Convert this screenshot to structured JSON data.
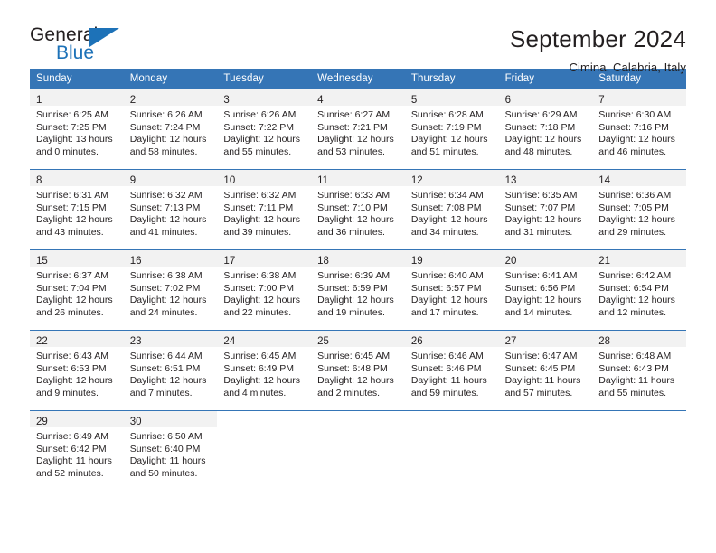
{
  "brand": {
    "name_top": "General",
    "name_bottom": "Blue",
    "accent_color": "#1d72b8"
  },
  "header": {
    "title": "September 2024",
    "location": "Cimina, Calabria, Italy"
  },
  "theme": {
    "header_band": "#3575b6",
    "day_strip": "#f2f2f2",
    "text": "#231f20"
  },
  "weekdays": [
    "Sunday",
    "Monday",
    "Tuesday",
    "Wednesday",
    "Thursday",
    "Friday",
    "Saturday"
  ],
  "weeks": [
    [
      {
        "day": "1",
        "sunrise": "Sunrise: 6:25 AM",
        "sunset": "Sunset: 7:25 PM",
        "daylight_1": "Daylight: 13 hours",
        "daylight_2": "and 0 minutes."
      },
      {
        "day": "2",
        "sunrise": "Sunrise: 6:26 AM",
        "sunset": "Sunset: 7:24 PM",
        "daylight_1": "Daylight: 12 hours",
        "daylight_2": "and 58 minutes."
      },
      {
        "day": "3",
        "sunrise": "Sunrise: 6:26 AM",
        "sunset": "Sunset: 7:22 PM",
        "daylight_1": "Daylight: 12 hours",
        "daylight_2": "and 55 minutes."
      },
      {
        "day": "4",
        "sunrise": "Sunrise: 6:27 AM",
        "sunset": "Sunset: 7:21 PM",
        "daylight_1": "Daylight: 12 hours",
        "daylight_2": "and 53 minutes."
      },
      {
        "day": "5",
        "sunrise": "Sunrise: 6:28 AM",
        "sunset": "Sunset: 7:19 PM",
        "daylight_1": "Daylight: 12 hours",
        "daylight_2": "and 51 minutes."
      },
      {
        "day": "6",
        "sunrise": "Sunrise: 6:29 AM",
        "sunset": "Sunset: 7:18 PM",
        "daylight_1": "Daylight: 12 hours",
        "daylight_2": "and 48 minutes."
      },
      {
        "day": "7",
        "sunrise": "Sunrise: 6:30 AM",
        "sunset": "Sunset: 7:16 PM",
        "daylight_1": "Daylight: 12 hours",
        "daylight_2": "and 46 minutes."
      }
    ],
    [
      {
        "day": "8",
        "sunrise": "Sunrise: 6:31 AM",
        "sunset": "Sunset: 7:15 PM",
        "daylight_1": "Daylight: 12 hours",
        "daylight_2": "and 43 minutes."
      },
      {
        "day": "9",
        "sunrise": "Sunrise: 6:32 AM",
        "sunset": "Sunset: 7:13 PM",
        "daylight_1": "Daylight: 12 hours",
        "daylight_2": "and 41 minutes."
      },
      {
        "day": "10",
        "sunrise": "Sunrise: 6:32 AM",
        "sunset": "Sunset: 7:11 PM",
        "daylight_1": "Daylight: 12 hours",
        "daylight_2": "and 39 minutes."
      },
      {
        "day": "11",
        "sunrise": "Sunrise: 6:33 AM",
        "sunset": "Sunset: 7:10 PM",
        "daylight_1": "Daylight: 12 hours",
        "daylight_2": "and 36 minutes."
      },
      {
        "day": "12",
        "sunrise": "Sunrise: 6:34 AM",
        "sunset": "Sunset: 7:08 PM",
        "daylight_1": "Daylight: 12 hours",
        "daylight_2": "and 34 minutes."
      },
      {
        "day": "13",
        "sunrise": "Sunrise: 6:35 AM",
        "sunset": "Sunset: 7:07 PM",
        "daylight_1": "Daylight: 12 hours",
        "daylight_2": "and 31 minutes."
      },
      {
        "day": "14",
        "sunrise": "Sunrise: 6:36 AM",
        "sunset": "Sunset: 7:05 PM",
        "daylight_1": "Daylight: 12 hours",
        "daylight_2": "and 29 minutes."
      }
    ],
    [
      {
        "day": "15",
        "sunrise": "Sunrise: 6:37 AM",
        "sunset": "Sunset: 7:04 PM",
        "daylight_1": "Daylight: 12 hours",
        "daylight_2": "and 26 minutes."
      },
      {
        "day": "16",
        "sunrise": "Sunrise: 6:38 AM",
        "sunset": "Sunset: 7:02 PM",
        "daylight_1": "Daylight: 12 hours",
        "daylight_2": "and 24 minutes."
      },
      {
        "day": "17",
        "sunrise": "Sunrise: 6:38 AM",
        "sunset": "Sunset: 7:00 PM",
        "daylight_1": "Daylight: 12 hours",
        "daylight_2": "and 22 minutes."
      },
      {
        "day": "18",
        "sunrise": "Sunrise: 6:39 AM",
        "sunset": "Sunset: 6:59 PM",
        "daylight_1": "Daylight: 12 hours",
        "daylight_2": "and 19 minutes."
      },
      {
        "day": "19",
        "sunrise": "Sunrise: 6:40 AM",
        "sunset": "Sunset: 6:57 PM",
        "daylight_1": "Daylight: 12 hours",
        "daylight_2": "and 17 minutes."
      },
      {
        "day": "20",
        "sunrise": "Sunrise: 6:41 AM",
        "sunset": "Sunset: 6:56 PM",
        "daylight_1": "Daylight: 12 hours",
        "daylight_2": "and 14 minutes."
      },
      {
        "day": "21",
        "sunrise": "Sunrise: 6:42 AM",
        "sunset": "Sunset: 6:54 PM",
        "daylight_1": "Daylight: 12 hours",
        "daylight_2": "and 12 minutes."
      }
    ],
    [
      {
        "day": "22",
        "sunrise": "Sunrise: 6:43 AM",
        "sunset": "Sunset: 6:53 PM",
        "daylight_1": "Daylight: 12 hours",
        "daylight_2": "and 9 minutes."
      },
      {
        "day": "23",
        "sunrise": "Sunrise: 6:44 AM",
        "sunset": "Sunset: 6:51 PM",
        "daylight_1": "Daylight: 12 hours",
        "daylight_2": "and 7 minutes."
      },
      {
        "day": "24",
        "sunrise": "Sunrise: 6:45 AM",
        "sunset": "Sunset: 6:49 PM",
        "daylight_1": "Daylight: 12 hours",
        "daylight_2": "and 4 minutes."
      },
      {
        "day": "25",
        "sunrise": "Sunrise: 6:45 AM",
        "sunset": "Sunset: 6:48 PM",
        "daylight_1": "Daylight: 12 hours",
        "daylight_2": "and 2 minutes."
      },
      {
        "day": "26",
        "sunrise": "Sunrise: 6:46 AM",
        "sunset": "Sunset: 6:46 PM",
        "daylight_1": "Daylight: 11 hours",
        "daylight_2": "and 59 minutes."
      },
      {
        "day": "27",
        "sunrise": "Sunrise: 6:47 AM",
        "sunset": "Sunset: 6:45 PM",
        "daylight_1": "Daylight: 11 hours",
        "daylight_2": "and 57 minutes."
      },
      {
        "day": "28",
        "sunrise": "Sunrise: 6:48 AM",
        "sunset": "Sunset: 6:43 PM",
        "daylight_1": "Daylight: 11 hours",
        "daylight_2": "and 55 minutes."
      }
    ],
    [
      {
        "day": "29",
        "sunrise": "Sunrise: 6:49 AM",
        "sunset": "Sunset: 6:42 PM",
        "daylight_1": "Daylight: 11 hours",
        "daylight_2": "and 52 minutes."
      },
      {
        "day": "30",
        "sunrise": "Sunrise: 6:50 AM",
        "sunset": "Sunset: 6:40 PM",
        "daylight_1": "Daylight: 11 hours",
        "daylight_2": "and 50 minutes."
      },
      {
        "day": "",
        "sunrise": "",
        "sunset": "",
        "daylight_1": "",
        "daylight_2": ""
      },
      {
        "day": "",
        "sunrise": "",
        "sunset": "",
        "daylight_1": "",
        "daylight_2": ""
      },
      {
        "day": "",
        "sunrise": "",
        "sunset": "",
        "daylight_1": "",
        "daylight_2": ""
      },
      {
        "day": "",
        "sunrise": "",
        "sunset": "",
        "daylight_1": "",
        "daylight_2": ""
      },
      {
        "day": "",
        "sunrise": "",
        "sunset": "",
        "daylight_1": "",
        "daylight_2": ""
      }
    ]
  ]
}
